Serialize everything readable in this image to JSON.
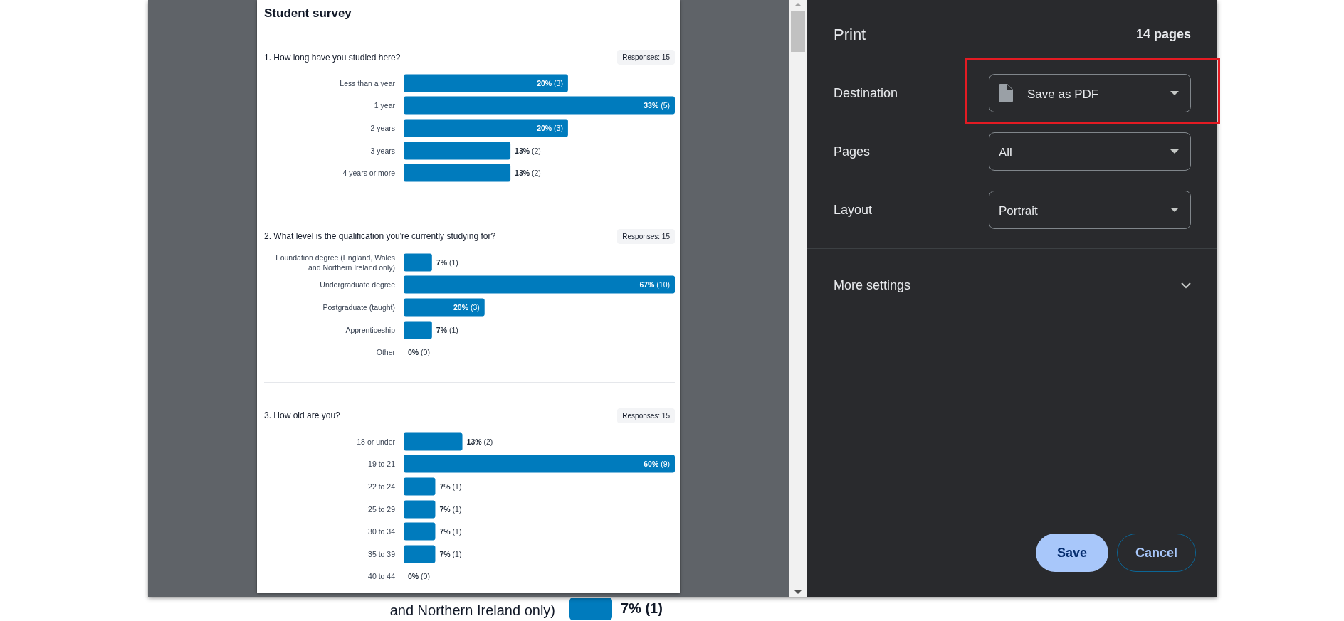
{
  "preview": {
    "title": "Student survey",
    "questions": [
      {
        "question": "1. How long have you studied here?",
        "responses": "Responses: 15",
        "chart_data": {
          "type": "bar",
          "orientation": "horizontal",
          "categories": [
            "Less than a year",
            "1 year",
            "2 years",
            "3 years",
            "4 years or more"
          ],
          "values": [
            20,
            33,
            20,
            13,
            13
          ],
          "value_labels": [
            "20% (3)",
            "33% (5)",
            "20% (3)",
            "13% (2)",
            "13% (2)"
          ]
        }
      },
      {
        "question": "2. What level is the qualification you're currently studying for?",
        "responses": "Responses: 15",
        "chart_data": {
          "type": "bar",
          "orientation": "horizontal",
          "categories": [
            "Foundation degree (England, Wales and Northern Ireland only)",
            "Undergraduate degree",
            "Postgraduate (taught)",
            "Apprenticeship",
            "Other"
          ],
          "values": [
            7,
            67,
            20,
            7,
            0
          ],
          "value_labels": [
            "7% (1)",
            "67% (10)",
            "20% (3)",
            "7% (1)",
            "0% (0)"
          ]
        }
      },
      {
        "question": "3. How old are you?",
        "responses": "Responses: 15",
        "chart_data": {
          "type": "bar",
          "orientation": "horizontal",
          "categories": [
            "18 or under",
            "19 to 21",
            "22 to 24",
            "25 to 29",
            "30 to 34",
            "35 to 39",
            "40 to 44"
          ],
          "values": [
            13,
            60,
            7,
            7,
            7,
            7,
            0
          ],
          "value_labels": [
            "13% (2)",
            "60% (9)",
            "7% (1)",
            "7% (1)",
            "7% (1)",
            "7% (1)",
            "0% (0)"
          ]
        }
      }
    ]
  },
  "print_panel": {
    "title": "Print",
    "page_count": "14 pages",
    "settings": [
      {
        "label": "Destination",
        "value": "Save as PDF",
        "kind": "destination",
        "highlighted": true
      },
      {
        "label": "Pages",
        "value": "All",
        "kind": "plain",
        "highlighted": false
      },
      {
        "label": "Layout",
        "value": "Portrait",
        "kind": "plain",
        "highlighted": false
      }
    ],
    "more_settings": {
      "label": "More settings",
      "expanded": false
    },
    "buttons": [
      {
        "label": "Save",
        "kind": "primary"
      },
      {
        "label": "Cancel",
        "kind": "secondary"
      }
    ]
  },
  "background_page": {
    "category_label": "and Northern Ireland only)",
    "value_label": "7% (1)"
  }
}
